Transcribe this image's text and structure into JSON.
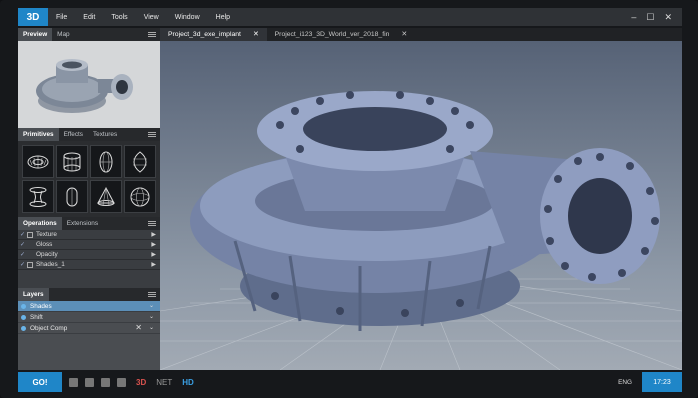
{
  "app": {
    "logo": "3D"
  },
  "menu": [
    "File",
    "Edit",
    "Tools",
    "View",
    "Window",
    "Help"
  ],
  "window_controls": {
    "minimize": "–",
    "maximize": "☐",
    "close": "✕"
  },
  "preview_tabs": [
    "Preview",
    "Map"
  ],
  "primitives_tabs": [
    "Primitives",
    "Effects",
    "Textures"
  ],
  "operations_tabs": [
    "Operations",
    "Extensions"
  ],
  "operations": [
    {
      "label": "Texture",
      "checked": true
    },
    {
      "label": "Gloss",
      "checked": false
    },
    {
      "label": "Opacity",
      "checked": false
    },
    {
      "label": "Shades_1",
      "checked": true
    }
  ],
  "layers_title": "Layers",
  "layers": [
    {
      "label": "Shades",
      "selected": true
    },
    {
      "label": "Shift",
      "selected": false
    },
    {
      "label": "Object Comp",
      "selected": false
    }
  ],
  "doc_tabs": [
    {
      "label": "Project_3d_exe_implant",
      "active": true
    },
    {
      "label": "Project_i123_3D_World_ver_2018_fin",
      "active": false
    }
  ],
  "taskbar": {
    "go": "GO!",
    "modes": [
      "3D",
      "NET",
      "HD"
    ],
    "lang": "ENG",
    "time": "17:23"
  },
  "colors": {
    "accent": "#1f86c8",
    "selection": "#5c8fb8"
  }
}
